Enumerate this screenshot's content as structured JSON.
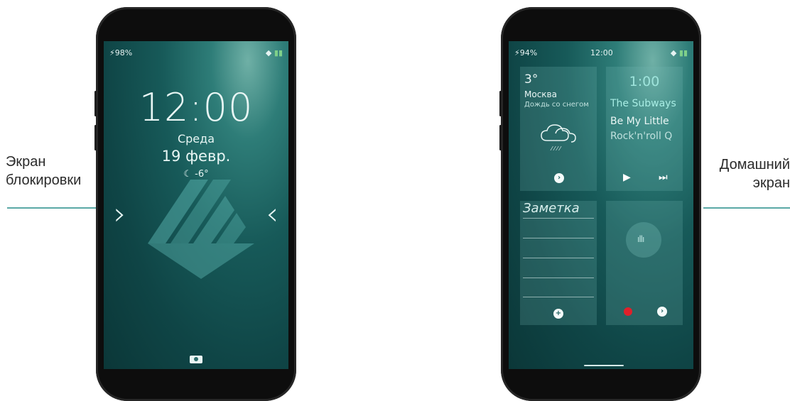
{
  "captions": {
    "left": [
      "Экран",
      "блокировки"
    ],
    "right": [
      "Домашний",
      "экран"
    ]
  },
  "lock": {
    "battery": "98%",
    "time": "12:00",
    "day": "Среда",
    "date": "19 февр.",
    "temp": "-6°"
  },
  "home": {
    "battery": "94%",
    "time": "12:00",
    "weather": {
      "temp": "3°",
      "city": "Москва",
      "desc": "Дождь со снегом"
    },
    "music": {
      "time": "1:00",
      "artist": "The Subways",
      "title_line1": "Be My Little",
      "title_line2": "Rock'n'roll Q"
    },
    "note": {
      "title": "Заметка"
    }
  },
  "colors": {
    "accent_line": "#5aa8a6",
    "record": "#e0202a",
    "screen_teal": "#175a59"
  }
}
